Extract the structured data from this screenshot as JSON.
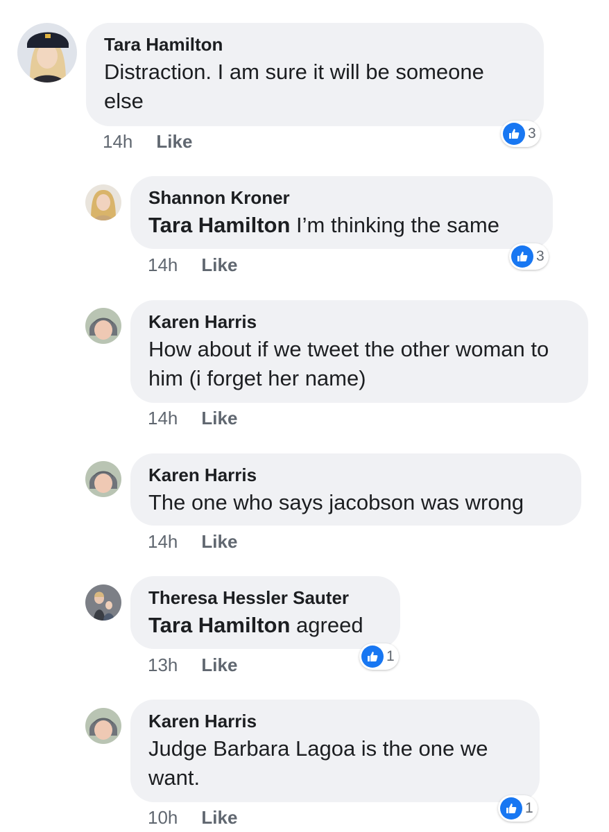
{
  "comments": [
    {
      "author": "Tara Hamilton",
      "mention": "",
      "text": "Distraction. I am sure it will be someone else",
      "time": "14h",
      "like_label": "Like",
      "reactions": "3"
    },
    {
      "author": "Shannon Kroner",
      "mention": "Tara Hamilton",
      "text": "I’m thinking the same",
      "time": "14h",
      "like_label": "Like",
      "reactions": "3"
    },
    {
      "author": "Karen Harris",
      "mention": "",
      "text": "How about if we tweet the other woman to him (i forget her name)",
      "time": "14h",
      "like_label": "Like",
      "reactions": ""
    },
    {
      "author": "Karen Harris",
      "mention": "",
      "text": "The one who says jacobson was wrong",
      "time": "14h",
      "like_label": "Like",
      "reactions": ""
    },
    {
      "author": "Theresa Hessler Sauter",
      "mention": "Tara Hamilton",
      "text": "agreed",
      "time": "13h",
      "like_label": "Like",
      "reactions": "1"
    },
    {
      "author": "Karen Harris",
      "mention": "",
      "text": "Judge Barbara Lagoa is the one we want.",
      "time": "10h",
      "like_label": "Like",
      "reactions": "1"
    }
  ],
  "colors": {
    "bubble": "#f0f1f4",
    "like_blue": "#1877f2",
    "meta_gray": "#606770"
  },
  "icons": {
    "reaction": "thumbs-up-icon"
  }
}
